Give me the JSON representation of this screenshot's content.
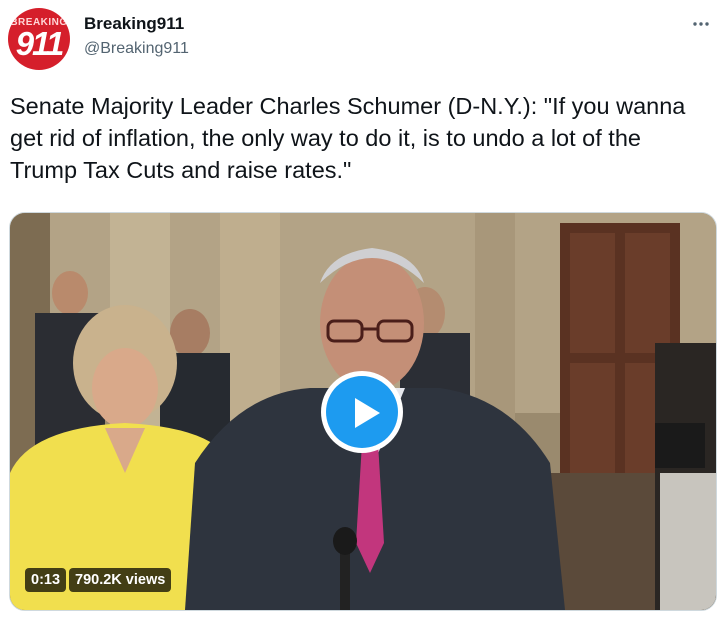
{
  "account": {
    "display_name": "Breaking911",
    "handle": "@Breaking911",
    "avatar_top_text": "BREAKING",
    "avatar_number": "911"
  },
  "menu_icon": "more-horizontal-icon",
  "tweet": {
    "text": "Senate Majority Leader Charles Schumer (D-N.Y.): \"If you wanna get rid of inflation, the only way to do it, is to undo a lot of the Trump Tax Cuts and raise rates.\""
  },
  "media": {
    "duration": "0:13",
    "views": "790.2K views",
    "play_icon": "play-icon"
  },
  "colors": {
    "accent": "#1d9bf0",
    "brand_red": "#d51f2b",
    "text_primary": "#0f1419",
    "text_secondary": "#536471"
  }
}
